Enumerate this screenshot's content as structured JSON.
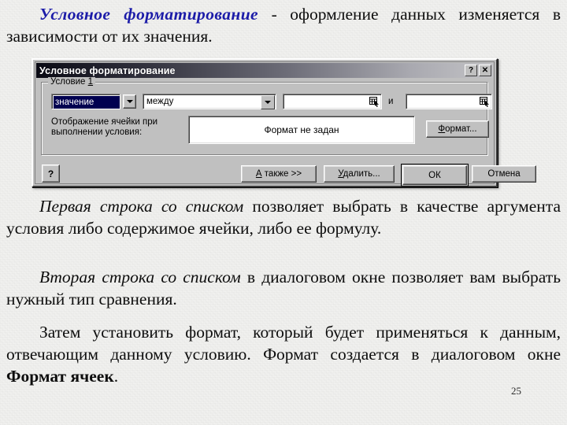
{
  "slide": {
    "page_number": "25",
    "heading": {
      "highlight": "Условное форматирование",
      "rest": " - оформление данных изменяется в зависимости от их значения."
    },
    "paragraphs": [
      {
        "italic_lead": "Первая строка со списком",
        "rest": " позволяет выбрать в качестве аргумента условия либо содержимое ячейки, либо ее формулу."
      },
      {
        "italic_lead": "Вторая строка со списком",
        "rest": " в диалоговом окне позволяет вам выбрать нужный тип сравнения."
      },
      {
        "lead": "Затем установить формат, который будет применяться к данным, отвечающим данному условию. Формат создается в диалоговом окне ",
        "bold": "Формат ячеек",
        "tail": "."
      }
    ]
  },
  "dialog": {
    "title": "Условное форматирование",
    "titlebar_buttons": [
      {
        "name": "help",
        "glyph": "?"
      },
      {
        "name": "close",
        "glyph": "✕"
      }
    ],
    "group": {
      "label_prefix": "Условие ",
      "label_accel": "1"
    },
    "condition_type_combo": {
      "value": "значение",
      "selected": true
    },
    "operator_combo": {
      "value": "между"
    },
    "value_field_1": {
      "value": "",
      "placeholder": ""
    },
    "between_conjunction": "и",
    "value_field_2": {
      "value": "",
      "placeholder": ""
    },
    "display_label_line1": "Отображение ячейки при",
    "display_label_line2": "выполнении условия:",
    "format_preview": "Формат не задан",
    "format_button": {
      "accel": "Ф",
      "rest": "ормат..."
    },
    "help_button_glyph": "?",
    "buttons": [
      {
        "name": "also",
        "accel": "А",
        "rest": " также >>"
      },
      {
        "name": "delete",
        "accel": "У",
        "rest": "далить..."
      },
      {
        "name": "ok",
        "label": "ОК",
        "default": true
      },
      {
        "name": "cancel",
        "label": "Отмена"
      }
    ]
  },
  "colors": {
    "heading_accent": "#1b1ba8",
    "dialog_face": "#c0c0c0",
    "selection": "#000050",
    "slide_background": "#f4f4f2"
  }
}
